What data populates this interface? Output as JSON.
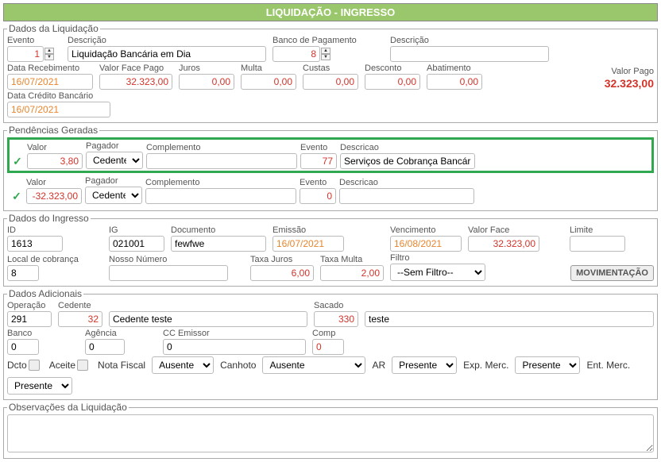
{
  "title": "LIQUIDAÇÃO - INGRESSO",
  "liquidacao": {
    "legend": "Dados da Liquidação",
    "evento_label": "Evento",
    "evento_value": "1",
    "descricao_label": "Descrição",
    "descricao_value": "Liquidação Bancária em Dia",
    "banco_pag_label": "Banco de Pagamento",
    "banco_pag_value": "8",
    "descricao2_label": "Descrição",
    "descricao2_value": "",
    "data_receb_label": "Data Recebimento",
    "data_receb_value": "16/07/2021",
    "valor_face_pago_label": "Valor Face Pago",
    "valor_face_pago_value": "32.323,00",
    "juros_label": "Juros",
    "juros_value": "0,00",
    "multa_label": "Multa",
    "multa_value": "0,00",
    "custas_label": "Custas",
    "custas_value": "0,00",
    "desconto_label": "Desconto",
    "desconto_value": "0,00",
    "abatimento_label": "Abatimento",
    "abatimento_value": "0,00",
    "valor_pago_label": "Valor Pago",
    "valor_pago_value": "32.323,00",
    "data_cred_label": "Data Crédito Bancário",
    "data_cred_value": "16/07/2021"
  },
  "pendencias": {
    "legend": "Pendências Geradas",
    "labels": {
      "valor": "Valor",
      "pagador": "Pagador",
      "complemento": "Complemento",
      "evento": "Evento",
      "descricao": "Descricao"
    },
    "rows": [
      {
        "valor": "3,80",
        "pagador": "Cedente",
        "complemento": "",
        "evento": "77",
        "descricao": "Serviços de Cobrança Bancár"
      },
      {
        "valor": "-32.323,00",
        "pagador": "Cedente",
        "complemento": "",
        "evento": "0",
        "descricao": ""
      }
    ]
  },
  "ingresso": {
    "legend": "Dados do Ingresso",
    "id_label": "ID",
    "id_value": "1613",
    "ig_label": "IG",
    "ig_value": "021001",
    "documento_label": "Documento",
    "documento_value": "fewfwe",
    "emissao_label": "Emissão",
    "emissao_value": "16/07/2021",
    "vencimento_label": "Vencimento",
    "vencimento_value": "16/08/2021",
    "valor_face_label": "Valor Face",
    "valor_face_value": "32.323,00",
    "limite_label": "Limite",
    "limite_value": "",
    "local_cob_label": "Local de cobrança",
    "local_cob_value": "8",
    "nosso_num_label": "Nosso Número",
    "nosso_num_value": "",
    "taxa_juros_label": "Taxa Juros",
    "taxa_juros_value": "6,00",
    "taxa_multa_label": "Taxa Multa",
    "taxa_multa_value": "2,00",
    "filtro_label": "Filtro",
    "filtro_value": "--Sem Filtro--",
    "movimentacao": "MOVIMENTAÇÃO"
  },
  "adicionais": {
    "legend": "Dados Adicionais",
    "operacao_label": "Operação",
    "operacao_value": "291",
    "cedente_label": "Cedente",
    "cedente_value": "32",
    "cedente_desc": "Cedente teste",
    "sacado_label": "Sacado",
    "sacado_value": "330",
    "sacado_desc": "teste",
    "banco_label": "Banco",
    "banco_value": "0",
    "agencia_label": "Agência",
    "agencia_value": "0",
    "cc_label": "CC Emissor",
    "cc_value": "0",
    "comp_label": "Comp",
    "comp_value": "0",
    "dcto_label": "Dcto",
    "aceite_label": "Aceite",
    "nota_fiscal_label": "Nota Fiscal",
    "nota_fiscal_value": "Ausente",
    "canhoto_label": "Canhoto",
    "canhoto_value": "Ausente",
    "ar_label": "AR",
    "ar_value": "Presente",
    "exp_label": "Exp. Merc.",
    "exp_value": "Presente",
    "ent_label": "Ent. Merc.",
    "ent_value": "Presente"
  },
  "observacoes": {
    "legend": "Observações da Liquidação",
    "value": ""
  }
}
